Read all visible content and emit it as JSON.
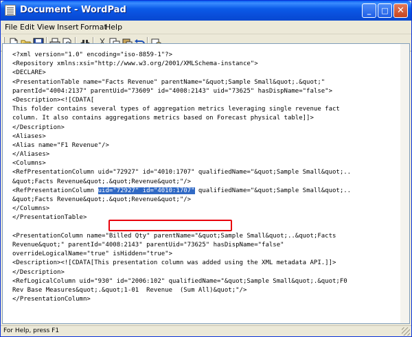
{
  "window": {
    "title": "Document - WordPad",
    "controls": [
      "_",
      "□",
      "✕"
    ]
  },
  "menu": [
    "File",
    "Edit",
    "View",
    "Insert",
    "Format",
    "Help"
  ],
  "toolbar": {
    "buttons": [
      "new-icon",
      "open-icon",
      "save-icon",
      "print-icon",
      "print-preview-icon",
      "find-icon",
      "cut-icon",
      "copy-icon",
      "paste-icon",
      "undo-icon",
      "date-time-icon"
    ]
  },
  "document": {
    "lines": [
      "<?xml version=\"1.0\" encoding=\"iso-8859-1\"?>",
      "<Repository xmlns:xsi=\"http://www.w3.org/2001/XMLSchema-instance\">",
      "<DECLARE>",
      "<PresentationTable name=\"Facts Revenue\" parentName=\"&quot;Sample Small&quot;.&quot;\"",
      "parentId=\"4004:2137\" parentUid=\"73609\" id=\"4008:2143\" uid=\"73625\" hasDispName=\"false\">",
      "<Description><![CDATA[",
      "This folder contains several types of aggregation metrics leveraging single revenue fact",
      "column. It also contains aggregations metrics based on Forecast physical table]]>",
      "</Description>",
      "<Aliases>",
      "<Alias name=\"F1 Revenue\"/>",
      "</Aliases>",
      "<Columns>",
      "<RefPresentationColumn uid=\"72927\" id=\"4010:1707\" qualifiedName=\"&quot;Sample Small&quot;..",
      "&quot;Facts Revenue&quot;.&quot;Revenue&quot;\"/>",
      "<RefPresentationColumn uid=\"72927\" id=\"4010:1707\" qualifiedName=\"&quot;Sample Small&quot;..",
      "&quot;Facts Revenue&quot;.&quot;Revenue&quot;\"/>",
      "</Columns>",
      "</PresentationTable>",
      "",
      "<PresentationColumn name=\"Billed Qty\" parentName=\"&quot;Sample Small&quot;..&quot;Facts",
      "Revenue&quot;\" parentId=\"4008:2143\" parentUid=\"73625\" hasDispName=\"false\"",
      "overrideLogicalName=\"true\" isHidden=\"true\">",
      "<Description><![CDATA[This presentation column was added using the XML metadata API.]]>",
      "</Description>",
      "<RefLogicalColumn uid=\"930\" id=\"2006:102\" qualifiedName=\"&quot;Sample Small&quot;.&quot;F0",
      "Rev Base Measures&quot;.&quot;1-01  Revenue  (Sum All)&quot;\"/>",
      "</PresentationColumn>"
    ],
    "highlight": {
      "before": "<RefPresentationColumn ",
      "selected": "uid=\"72927\" id=\"4010:1707\"",
      "after": " qualifiedName=\"&quot;Sample Small&quot;.."
    }
  },
  "status": {
    "text": "For Help, press F1"
  }
}
